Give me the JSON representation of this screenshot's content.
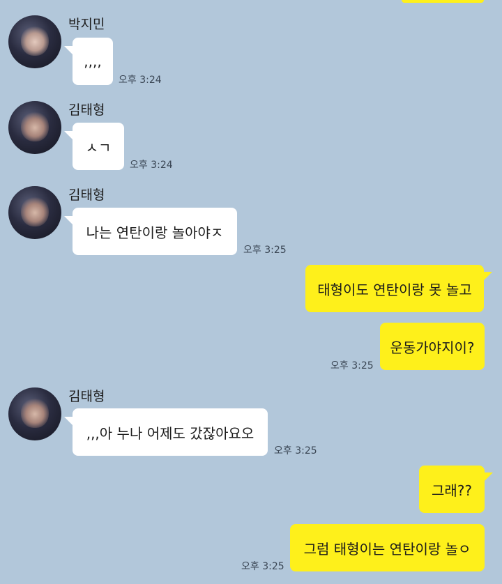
{
  "chat": {
    "colors": {
      "background": "#b2c7da",
      "incoming_bubble": "#ffffff",
      "outgoing_bubble": "#fef01b"
    },
    "messages": [
      {
        "sender": "박지민",
        "avatar": "jimin-avatar",
        "text": ",,,,",
        "time": "오후 3:24"
      },
      {
        "sender": "김태형",
        "avatar": "taehyung-avatar",
        "text": "ㅅㄱ",
        "time": "오후 3:24"
      },
      {
        "sender": "김태형",
        "avatar": "taehyung-avatar",
        "text": "나는 연탄이랑 놀아야ㅈ",
        "time": "오후 3:25"
      },
      {
        "sender": "me",
        "text": "태형이도 연탄이랑 못 놀고"
      },
      {
        "sender": "me",
        "text": "운동가야지이?",
        "time": "오후 3:25"
      },
      {
        "sender": "김태형",
        "avatar": "taehyung-avatar",
        "text": ",,,아 누나 어제도 갔잖아요오",
        "time": "오후 3:25"
      },
      {
        "sender": "me",
        "text": "그래??"
      },
      {
        "sender": "me",
        "text": "그럼 태형이는 연탄이랑 놀ㅇ",
        "time": "오후 3:25"
      }
    ]
  }
}
